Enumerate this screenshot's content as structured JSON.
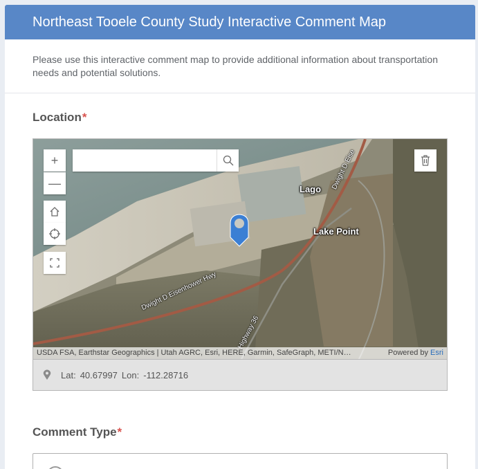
{
  "header": {
    "title": "Northeast Tooele County Study Interactive Comment Map"
  },
  "intro": {
    "text": "Please use this interactive comment map to provide additional information about transportation needs and potential solutions."
  },
  "location": {
    "label": "Location",
    "required_mark": "*",
    "search": {
      "placeholder": "",
      "value": ""
    },
    "place_labels": {
      "lago": "Lago",
      "lake_point": "Lake Point"
    },
    "road_labels": {
      "eisenhower": "Dwight D Eisenhower Hwy",
      "eisenhower_ne": "Dwight D Eise",
      "highway36": "Highway 36"
    },
    "attribution": "USDA FSA, Earthstar Geographics | Utah AGRC, Esri, HERE, Garmin, SafeGraph, METI/N…",
    "powered_by": "Powered by",
    "powered_by_link": "Esri",
    "lat_label": "Lat:",
    "lat_value": "40.67997",
    "lon_label": "Lon:",
    "lon_value": "-112.28716"
  },
  "comment_type": {
    "label": "Comment Type",
    "required_mark": "*"
  },
  "icons": [
    "zoom-in-icon",
    "zoom-out-icon",
    "home-icon",
    "locate-icon",
    "fullscreen-icon",
    "search-icon",
    "trash-icon",
    "map-pin-icon",
    "location-marker-icon"
  ],
  "colors": {
    "header": "#5887c7",
    "required": "#d9534f",
    "pin": "#3b7fd4"
  }
}
